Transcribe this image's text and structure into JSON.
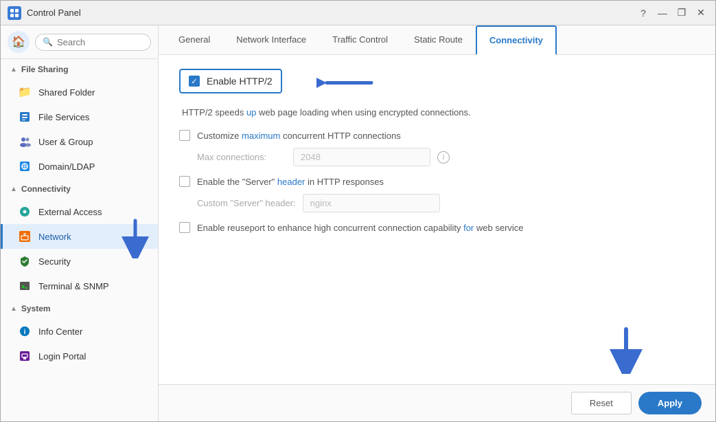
{
  "window": {
    "title": "Control Panel",
    "controls": {
      "help": "?",
      "minimize": "—",
      "maximize": "❐",
      "close": "✕"
    }
  },
  "sidebar": {
    "search_placeholder": "Search",
    "sections": [
      {
        "id": "file-sharing",
        "label": "File Sharing",
        "expanded": true,
        "items": [
          {
            "id": "shared-folder",
            "label": "Shared Folder",
            "icon": "folder"
          },
          {
            "id": "file-services",
            "label": "File Services",
            "icon": "file-services"
          },
          {
            "id": "user-group",
            "label": "User & Group",
            "icon": "user"
          },
          {
            "id": "domain-ldap",
            "label": "Domain/LDAP",
            "icon": "domain"
          }
        ]
      },
      {
        "id": "connectivity",
        "label": "Connectivity",
        "expanded": true,
        "items": [
          {
            "id": "external-access",
            "label": "External Access",
            "icon": "external"
          },
          {
            "id": "network",
            "label": "Network",
            "icon": "network",
            "active": true
          },
          {
            "id": "security",
            "label": "Security",
            "icon": "security"
          },
          {
            "id": "terminal-snmp",
            "label": "Terminal & SNMP",
            "icon": "terminal"
          }
        ]
      },
      {
        "id": "system",
        "label": "System",
        "expanded": true,
        "items": [
          {
            "id": "info-center",
            "label": "Info Center",
            "icon": "info"
          },
          {
            "id": "login-portal",
            "label": "Login Portal",
            "icon": "login"
          }
        ]
      }
    ]
  },
  "tabs": [
    {
      "id": "general",
      "label": "General"
    },
    {
      "id": "network-interface",
      "label": "Network Interface"
    },
    {
      "id": "traffic-control",
      "label": "Traffic Control"
    },
    {
      "id": "static-route",
      "label": "Static Route"
    },
    {
      "id": "connectivity",
      "label": "Connectivity",
      "active": true
    }
  ],
  "panel": {
    "enable_http2": {
      "label": "Enable HTTP/2",
      "checked": true,
      "description_prefix": "HTTP/2 speeds ",
      "description_highlight": "up",
      "description_suffix": " web page loading when using encrypted connections."
    },
    "customize_connections": {
      "label_prefix": "Customize maximum concurrent HTTP connections",
      "checked": false
    },
    "max_connections": {
      "label": "Max connections:",
      "value": "2048"
    },
    "server_header": {
      "label_prefix": "Enable the \"Server\" header in HTTP responses",
      "checked": false
    },
    "custom_server_header": {
      "label": "Custom \"Server\" header:",
      "value": "nginx"
    },
    "reuseport": {
      "label_prefix": "Enable reuseport to enhance high concurrent connection capability ",
      "label_highlight": "for",
      "label_suffix": " web service",
      "checked": false
    }
  },
  "buttons": {
    "reset": "Reset",
    "apply": "Apply"
  }
}
